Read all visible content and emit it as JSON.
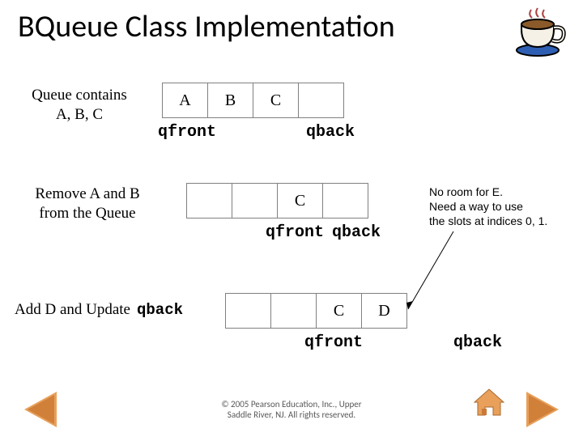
{
  "title": "BQueue Class Implementation",
  "rows": [
    {
      "label_l1": "Queue contains",
      "label_l2": "A, B, C",
      "cells": [
        "A",
        "B",
        "C",
        ""
      ],
      "qfront_under": 0,
      "qback_under": 3
    },
    {
      "label_l1": "Remove A and B",
      "label_l2": "from the Queue",
      "cells": [
        "",
        "",
        "C",
        ""
      ],
      "qfront_under": 2,
      "qback_under": 3
    },
    {
      "label_l1": "Add D and Update",
      "mono_after": "qback",
      "cells": [
        "",
        "",
        "C",
        "D"
      ],
      "qfront_under": 2,
      "qback_outside": true
    }
  ],
  "pointer_labels": {
    "front": "qfront",
    "back": "qback"
  },
  "annotation": {
    "l1": "No room for E.",
    "l2": "Need a way to use",
    "l3": "the slots at indices 0, 1."
  },
  "footer": {
    "l1": "© 2005 Pearson Education, Inc., Upper",
    "l2": "Saddle River, NJ. All rights reserved."
  },
  "icons": {
    "teacup": "teacup-icon",
    "prev": "prev-slide",
    "next": "next-slide",
    "home": "home-slide"
  }
}
